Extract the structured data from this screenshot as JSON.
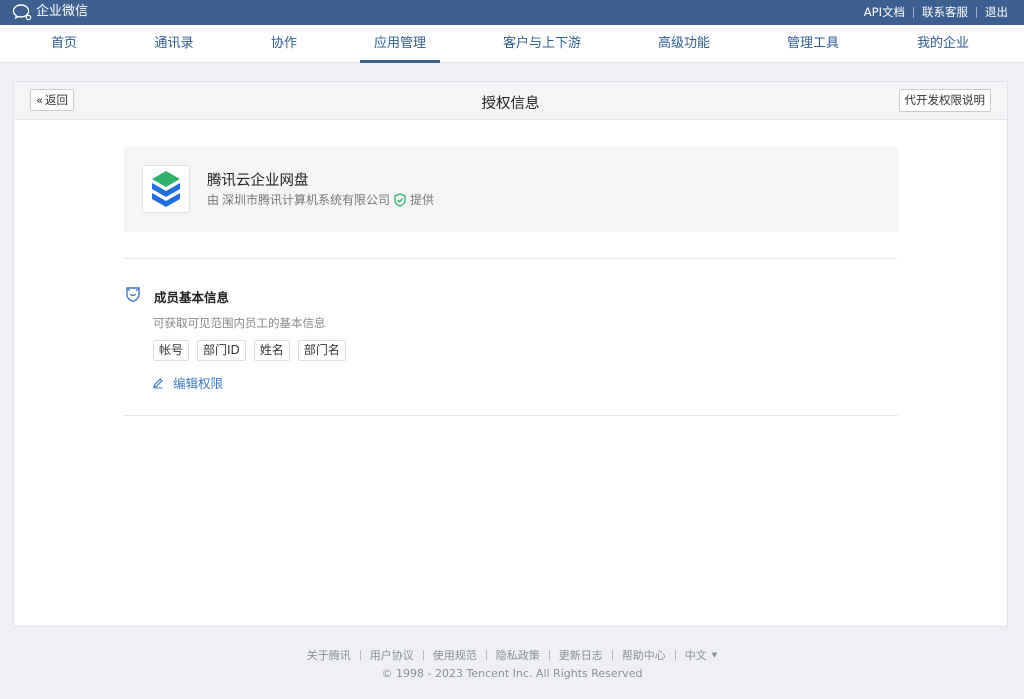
{
  "topbar": {
    "brand": "企业微信",
    "links": [
      "API文档",
      "联系客服",
      "退出"
    ]
  },
  "nav": {
    "items": [
      "首页",
      "通讯录",
      "协作",
      "应用管理",
      "客户与上下游",
      "高级功能",
      "管理工具",
      "我的企业"
    ],
    "active": "应用管理"
  },
  "card": {
    "back_label": "返回",
    "title": "授权信息",
    "explain_label": "代开发权限说明"
  },
  "app": {
    "name": "腾讯云企业网盘",
    "provider_prefix": "由",
    "provider_name": "深圳市腾讯计算机系统有限公司",
    "provider_suffix": "提供"
  },
  "permission": {
    "title": "成员基本信息",
    "description": "可获取可见范围内员工的基本信息",
    "fields": [
      "帐号",
      "部门ID",
      "姓名",
      "部门名"
    ],
    "edit_label": "编辑权限"
  },
  "footer": {
    "links": [
      "关于腾讯",
      "用户协议",
      "使用规范",
      "隐私政策",
      "更新日志",
      "帮助中心"
    ],
    "language": "中文",
    "copyright": "© 1998 - 2023 Tencent Inc. All Rights Reserved"
  },
  "colors": {
    "topbar": "#3c6190",
    "link": "#3f78c8",
    "verify": "#2fb36b"
  }
}
